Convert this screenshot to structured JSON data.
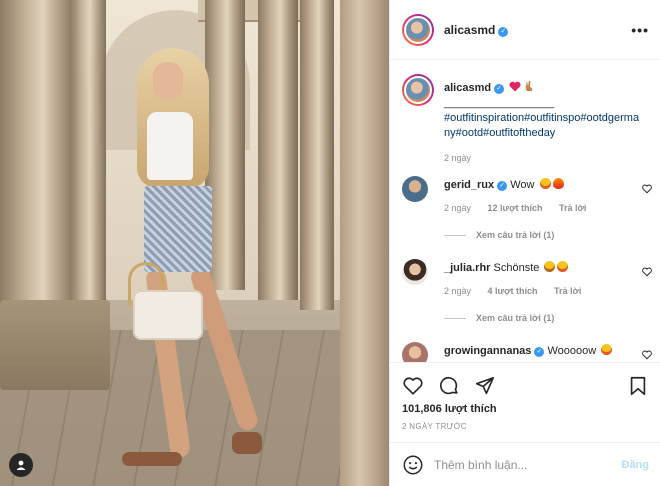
{
  "post": {
    "author": "alicasmd",
    "author_verified": true,
    "more_icon": "ellipsis"
  },
  "caption": {
    "author": "alicasmd",
    "text_emojis": [
      "red-heart",
      "victory-hand"
    ],
    "divider": "__________________",
    "hashtags": "#outfitinspiration#outfitinspo#ootdgermany#ootd#outfitoftheday",
    "time": "2 ngày"
  },
  "comments": [
    {
      "author": "gerid_rux",
      "verified": true,
      "text": "Wow",
      "emojis": [
        "star-struck",
        "fire"
      ],
      "time": "2 ngày",
      "likes": "12 lượt thích",
      "reply": "Trả lời",
      "view_replies": "Xem câu trả lời (1)"
    },
    {
      "author": "_julia.rhr",
      "verified": false,
      "text": "Schönste",
      "emojis": [
        "laughing",
        "star-struck"
      ],
      "time": "2 ngày",
      "likes": "4 lượt thích",
      "reply": "Trả lời",
      "view_replies": "Xem câu trả lời (1)"
    },
    {
      "author": "growingannanas",
      "verified": true,
      "text": "Wooooow",
      "emojis": [
        "star-struck"
      ]
    }
  ],
  "actions": {
    "like_icon": "heart-outline",
    "comment_icon": "speech-bubble",
    "share_icon": "paper-plane",
    "save_icon": "bookmark",
    "likes": "101,806 lượt thích",
    "timestamp": "2 NGÀY TRƯỚC"
  },
  "add_comment": {
    "placeholder": "Thêm bình luận...",
    "post_label": "Đăng"
  },
  "colors": {
    "link": "#00376b",
    "verified": "#3897f0",
    "muted": "#8e8e8e",
    "post_disabled": "#b2dffc"
  }
}
